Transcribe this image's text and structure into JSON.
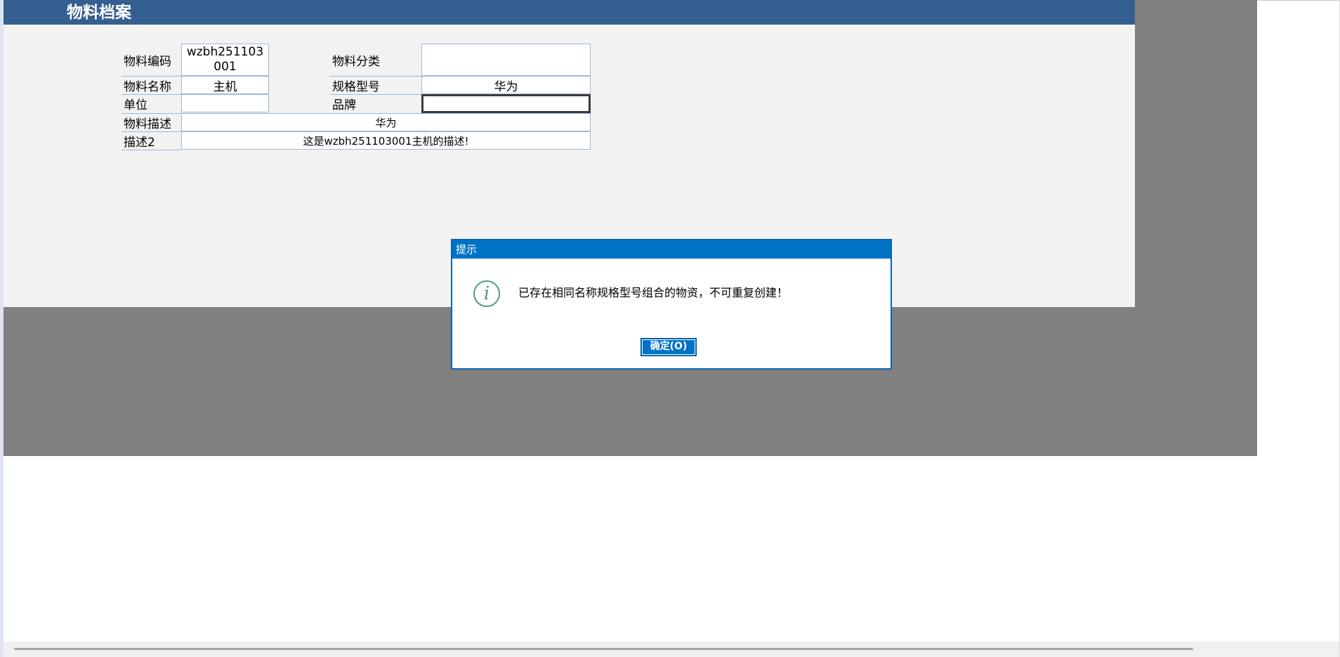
{
  "sheet": {
    "title": "物料档案"
  },
  "form": {
    "code_label": "物料编码",
    "code_value": "wzbh251103001",
    "category_label": "物料分类",
    "category_value": "",
    "name_label": "物料名称",
    "name_value": "主机",
    "spec_label": "规格型号",
    "spec_value": "华为",
    "unit_label": "单位",
    "unit_value": "",
    "brand_label": "品牌",
    "brand_value": "",
    "desc_label": "物料描述",
    "desc_value": "华为",
    "desc2_label": "描述2",
    "desc2_value": "这是wzbh251103001主机的描述!"
  },
  "dialog": {
    "title": "提示",
    "icon": "info-icon",
    "message": "已存在相同名称规格型号组合的物资，不可重复创建！",
    "ok_label": "确定(O)"
  },
  "colors": {
    "title_bar": "#355e91",
    "dialog_blue": "#0072c6",
    "panel_bg": "#f2f2f2",
    "backdrop": "#808080",
    "cell_border": "#9fb6d8"
  }
}
